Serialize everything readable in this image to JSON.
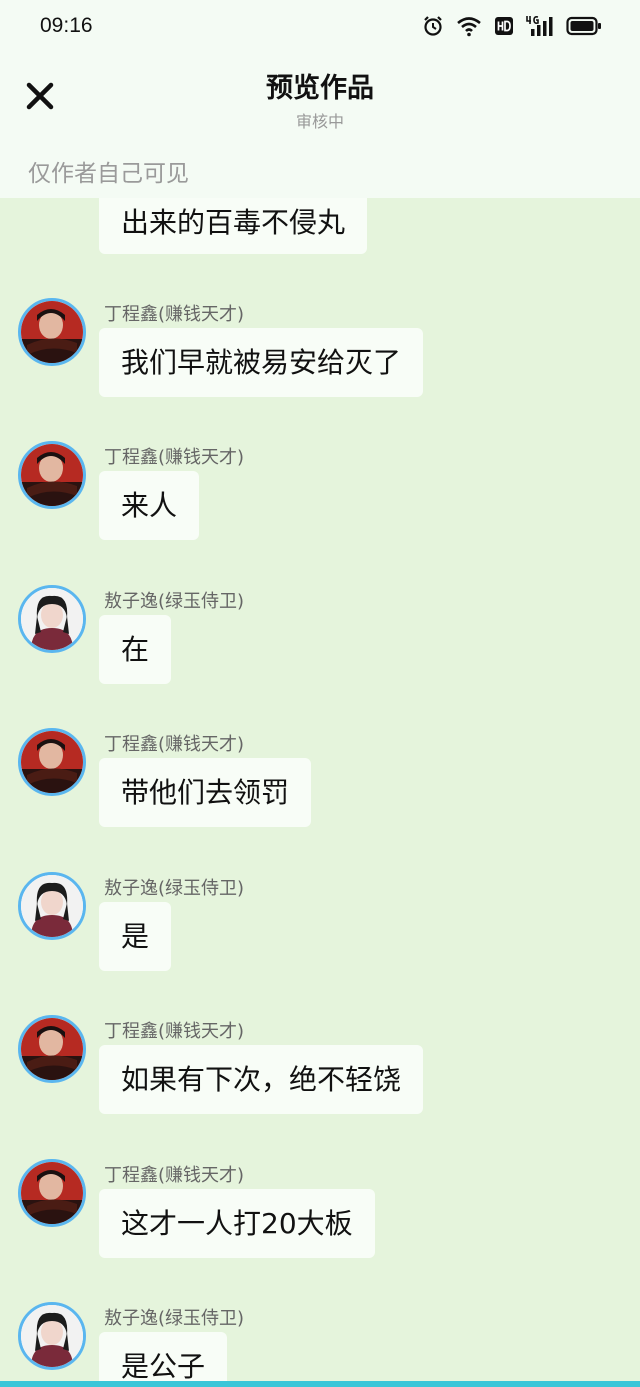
{
  "status_bar": {
    "time": "09:16"
  },
  "header": {
    "title": "预览作品",
    "subtitle": "审核中",
    "visibility": "仅作者自己可见"
  },
  "messages": [
    {
      "speaker": "",
      "text": "出来的百毒不侵丸"
    },
    {
      "speaker": "丁程鑫(赚钱天才)",
      "text": "我们早就被易安给灭了"
    },
    {
      "speaker": "丁程鑫(赚钱天才)",
      "text": "来人"
    },
    {
      "speaker": "敖子逸(绿玉侍卫)",
      "text": "在"
    },
    {
      "speaker": "丁程鑫(赚钱天才)",
      "text": "带他们去领罚"
    },
    {
      "speaker": "敖子逸(绿玉侍卫)",
      "text": "是"
    },
    {
      "speaker": "丁程鑫(赚钱天才)",
      "text": "如果有下次，绝不轻饶"
    },
    {
      "speaker": "丁程鑫(赚钱天才)",
      "text": "这才一人打20大板"
    },
    {
      "speaker": "敖子逸(绿玉侍卫)",
      "text": "是公子"
    }
  ]
}
